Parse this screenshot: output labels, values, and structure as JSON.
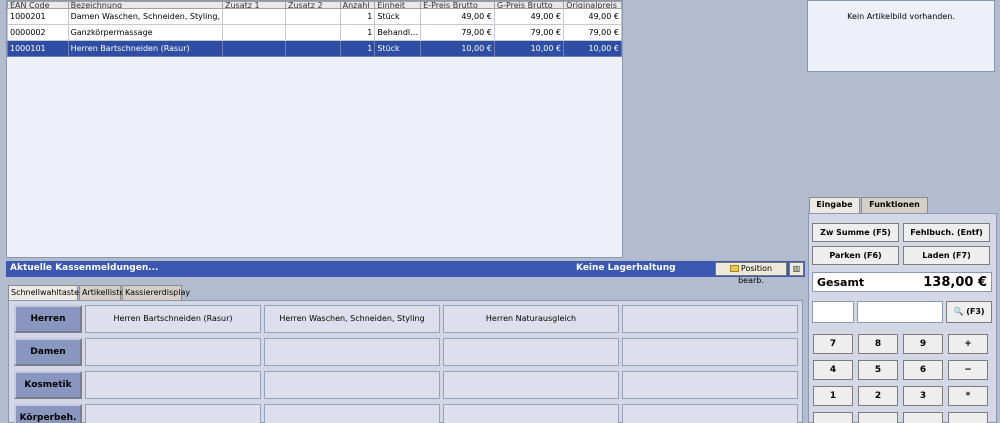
{
  "grid": {
    "columns": [
      "EAN Code",
      "Bezeichnung",
      "Zusatz 1",
      "Zusatz 2",
      "Anzahl",
      "Einheit",
      "E-Preis Brutto",
      "G-Preis Brutto",
      "Originalpreis"
    ],
    "rows": [
      {
        "ean": "1000201",
        "bez": "Damen Waschen, Schneiden, Styling,",
        "z1": "",
        "z2": "",
        "anz": "1",
        "einheit": "Stück",
        "epreis": "49,00 €",
        "gpreis": "49,00 €",
        "orig": "49,00 €"
      },
      {
        "ean": "0000002",
        "bez": "Ganzkörpermassage",
        "z1": "",
        "z2": "",
        "anz": "1",
        "einheit": "Behandl…",
        "epreis": "79,00 €",
        "gpreis": "79,00 €",
        "orig": "79,00 €"
      },
      {
        "ean": "1000101",
        "bez": "Herren Bartschneiden (Rasur)",
        "z1": "",
        "z2": "",
        "anz": "1",
        "einheit": "Stück",
        "epreis": "10,00 €",
        "gpreis": "10,00 €",
        "orig": "10,00 €"
      }
    ]
  },
  "msgbar": {
    "message": "Aktuelle Kassenmeldungen...",
    "lager": "Keine Lagerhaltung",
    "position_button": "Position bearb.",
    "calc_icon": "grid-icon"
  },
  "tabs": {
    "schnellwahl": "Schnellwahltasten",
    "artikelliste": "Artikelliste",
    "kassierer": "Kassiererdisplay"
  },
  "categories": [
    "Herren",
    "Damen",
    "Kosmetik",
    "Körperbeh."
  ],
  "quickkeys": {
    "row0": [
      "Herren Bartschneiden (Rasur)",
      "Herren Waschen, Schneiden, Styling",
      "Herren Naturausgleich",
      ""
    ]
  },
  "right": {
    "no_image": "Kein Artikelbild vorhanden.",
    "tab_eingabe": "Eingabe",
    "tab_funktionen": "Funktionen",
    "btn_zwsumme": "Zw Summe (F5)",
    "btn_fehlbuch": "Fehlbuch. (Entf)",
    "btn_parken": "Parken (F6)",
    "btn_laden": "Laden (F7)",
    "total_label": "Gesamt",
    "total_value": "138,00 €",
    "btn_f3": "(F3)",
    "search_icon": "binoculars-icon",
    "keys": [
      "7",
      "8",
      "9",
      "+",
      "4",
      "5",
      "6",
      "−",
      "1",
      "2",
      "3",
      "*"
    ]
  },
  "colors": {
    "selection": "#2f4ea3",
    "msgbar": "#3a58b0",
    "background": "#b3bccf",
    "category": "#8996c0"
  }
}
